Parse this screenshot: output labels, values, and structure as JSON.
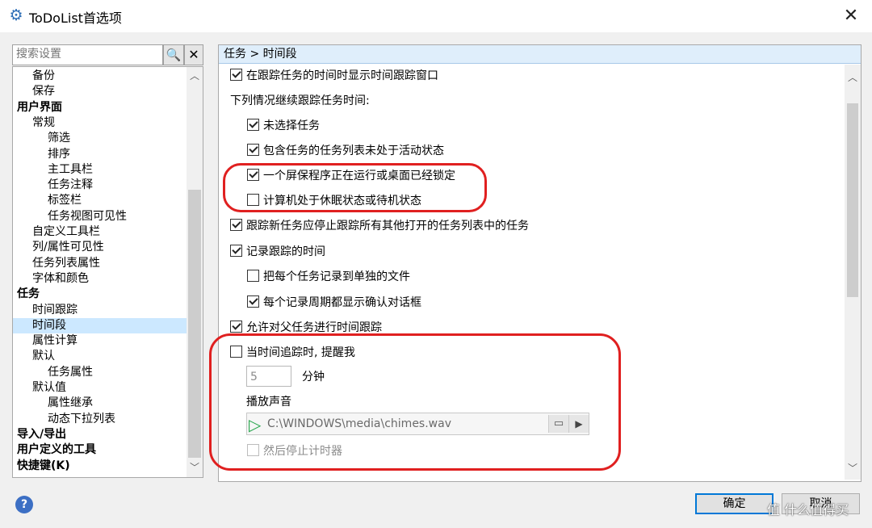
{
  "window": {
    "title": "ToDoList首选项",
    "icon": "gear-icon"
  },
  "search": {
    "placeholder": "搜索设置",
    "search_icon": "magnifier-icon",
    "clear_label": "✕"
  },
  "tree": {
    "items": [
      {
        "label": "备份",
        "level": 1
      },
      {
        "label": "保存",
        "level": 1
      },
      {
        "label": "用户界面",
        "level": 0,
        "bold": true
      },
      {
        "label": "常规",
        "level": 1
      },
      {
        "label": "筛选",
        "level": 2
      },
      {
        "label": "排序",
        "level": 2
      },
      {
        "label": "主工具栏",
        "level": 2
      },
      {
        "label": "任务注释",
        "level": 2
      },
      {
        "label": "标签栏",
        "level": 2
      },
      {
        "label": "任务视图可见性",
        "level": 2
      },
      {
        "label": "自定义工具栏",
        "level": 1
      },
      {
        "label": "列/属性可见性",
        "level": 1
      },
      {
        "label": "任务列表属性",
        "level": 1
      },
      {
        "label": "字体和颜色",
        "level": 1
      },
      {
        "label": "任务",
        "level": 0,
        "bold": true
      },
      {
        "label": "时间跟踪",
        "level": 1
      },
      {
        "label": "时间段",
        "level": 1,
        "selected": true
      },
      {
        "label": "属性计算",
        "level": 1
      },
      {
        "label": "默认",
        "level": 1
      },
      {
        "label": "任务属性",
        "level": 2
      },
      {
        "label": "默认值",
        "level": 1
      },
      {
        "label": "属性继承",
        "level": 2
      },
      {
        "label": "动态下拉列表",
        "level": 2
      },
      {
        "label": "导入/导出",
        "level": 0,
        "bold": true
      },
      {
        "label": "用户定义的工具",
        "level": 0,
        "bold": true
      },
      {
        "label": "快捷键(K)",
        "level": 0,
        "bold": true
      }
    ]
  },
  "breadcrumb": "任务 > 时间段",
  "options": {
    "track_window": {
      "label": "在跟踪任务的时间时显示时间跟踪窗口",
      "checked": true
    },
    "continue_header": "下列情况继续跟踪任务时间:",
    "no_selection": {
      "label": "未选择任务",
      "checked": true
    },
    "list_inactive": {
      "label": "包含任务的任务列表未处于活动状态",
      "checked": true
    },
    "screensaver": {
      "label": "一个屏保程序正在运行或桌面已经锁定",
      "checked": true
    },
    "sleep": {
      "label": "计算机处于休眠状态或待机状态",
      "checked": false
    },
    "stop_others": {
      "label": "跟踪新任务应停止跟踪所有其他打开的任务列表中的任务",
      "checked": true
    },
    "log_time": {
      "label": "记录跟踪的时间",
      "checked": true
    },
    "separate_file": {
      "label": "把每个任务记录到单独的文件",
      "checked": false
    },
    "confirm_dialog": {
      "label": "每个记录周期都显示确认对话框",
      "checked": true
    },
    "parent_tracking": {
      "label": "允许对父任务进行时间跟踪",
      "checked": true
    },
    "remind": {
      "label": "当时间追踪时, 提醒我",
      "checked": false
    },
    "minutes_value": "5",
    "minutes_unit": "分钟",
    "sound_label": "播放声音",
    "sound_path": "C:\\WINDOWS\\media\\chimes.wav",
    "stop_timer": {
      "label": "然后停止计时器",
      "checked": false
    }
  },
  "buttons": {
    "ok": "确定",
    "cancel": "取消",
    "help": "?"
  },
  "watermark": "值 什么值得买",
  "colors": {
    "selection": "#cce8ff",
    "highlight_ring": "#e02020",
    "breadcrumb_bg": "#dfeefb",
    "default_button_border": "#0078d7"
  }
}
